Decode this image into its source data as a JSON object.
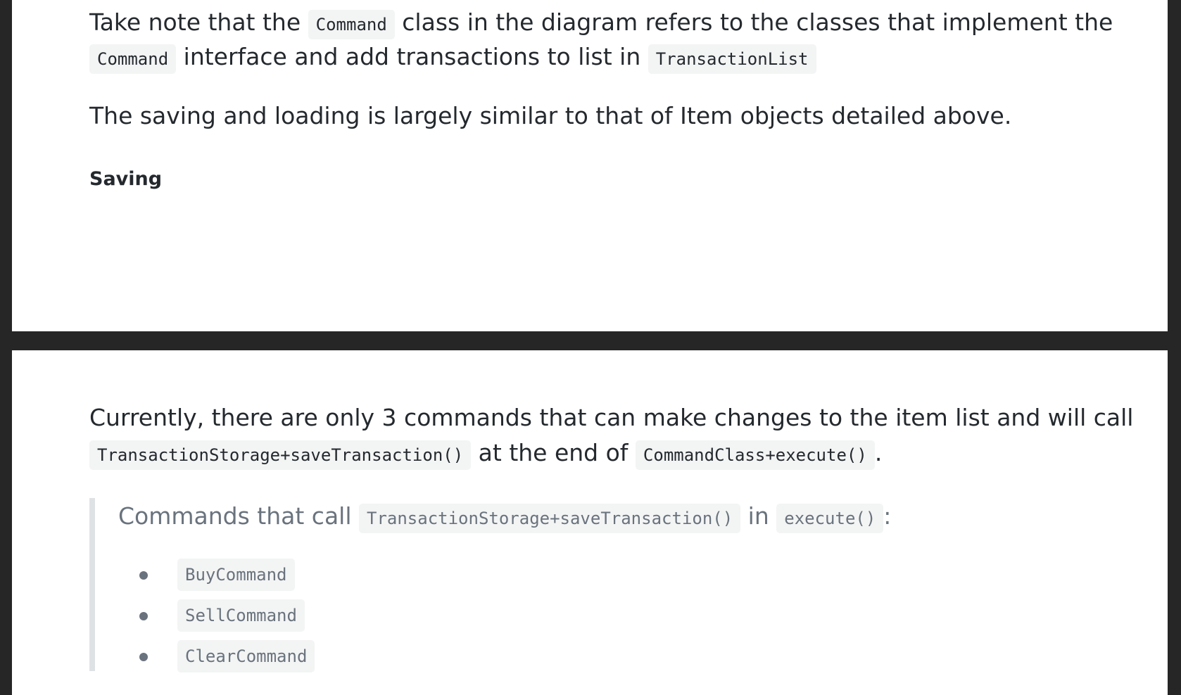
{
  "top_page": {
    "note": {
      "part1": "Take note that the ",
      "code1": "Command",
      "part2": " class in the diagram refers to the classes that implement the",
      "code2": "Command",
      "part3": " interface and add transactions to list in ",
      "code3": "TransactionList"
    },
    "saving_loading_text": "The saving and loading is largely similar to that of Item objects detailed above.",
    "saving_heading": "Saving"
  },
  "bottom_page": {
    "intro": {
      "part1": "Currently, there are only 3 commands that can make changes to the item list and will call",
      "code1": "TransactionStorage+saveTransaction()",
      "part2": " at the end of ",
      "code2": "CommandClass+execute()",
      "part3": "."
    },
    "quote": {
      "part1": "Commands that call ",
      "code1": "TransactionStorage+saveTransaction()",
      "part2": " in ",
      "code2": "execute()",
      "part3": ":"
    },
    "commands": [
      "BuyCommand",
      "SellCommand",
      "ClearCommand"
    ]
  }
}
